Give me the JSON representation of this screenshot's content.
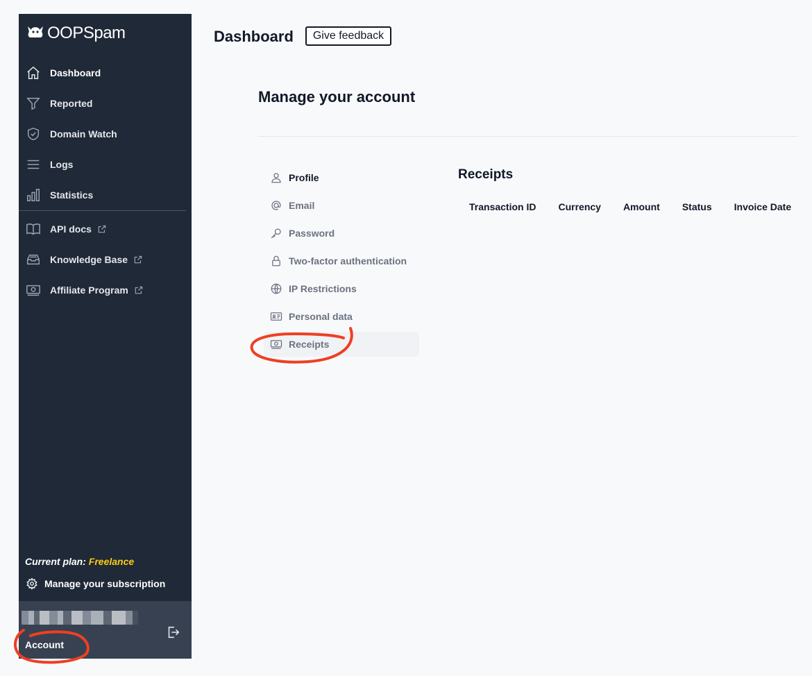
{
  "brand": {
    "name": "OOPSpam"
  },
  "sidebar": {
    "items": [
      {
        "label": "Dashboard",
        "icon": "home-icon"
      },
      {
        "label": "Reported",
        "icon": "filter-icon"
      },
      {
        "label": "Domain Watch",
        "icon": "shield-check-icon"
      },
      {
        "label": "Logs",
        "icon": "menu-lines-icon"
      },
      {
        "label": "Statistics",
        "icon": "bar-chart-icon"
      }
    ],
    "external_links": [
      {
        "label": "API docs",
        "icon": "book-open-icon"
      },
      {
        "label": "Knowledge Base",
        "icon": "inbox-stack-icon"
      },
      {
        "label": "Affiliate Program",
        "icon": "banknotes-icon"
      }
    ],
    "plan_prefix": "Current plan:",
    "plan_name": "Freelance",
    "manage_subscription": "Manage your subscription",
    "account_label": "Account"
  },
  "header": {
    "title": "Dashboard",
    "feedback_label": "Give feedback"
  },
  "account": {
    "title": "Manage your account",
    "nav": [
      {
        "label": "Profile",
        "icon": "user-icon"
      },
      {
        "label": "Email",
        "icon": "at-sign-icon"
      },
      {
        "label": "Password",
        "icon": "key-icon"
      },
      {
        "label": "Two-factor authentication",
        "icon": "lock-icon"
      },
      {
        "label": "IP Restrictions",
        "icon": "globe-icon"
      },
      {
        "label": "Personal data",
        "icon": "id-card-icon"
      },
      {
        "label": "Receipts",
        "icon": "banknotes-icon"
      }
    ],
    "active": "Receipts"
  },
  "receipts": {
    "title": "Receipts",
    "columns": [
      "Transaction ID",
      "Currency",
      "Amount",
      "Status",
      "Invoice Date"
    ]
  },
  "colors": {
    "sidebar_bg": "#1f2937",
    "account_box_bg": "#374151",
    "plan_accent": "#facc15",
    "annotation": "#ee3f23"
  }
}
